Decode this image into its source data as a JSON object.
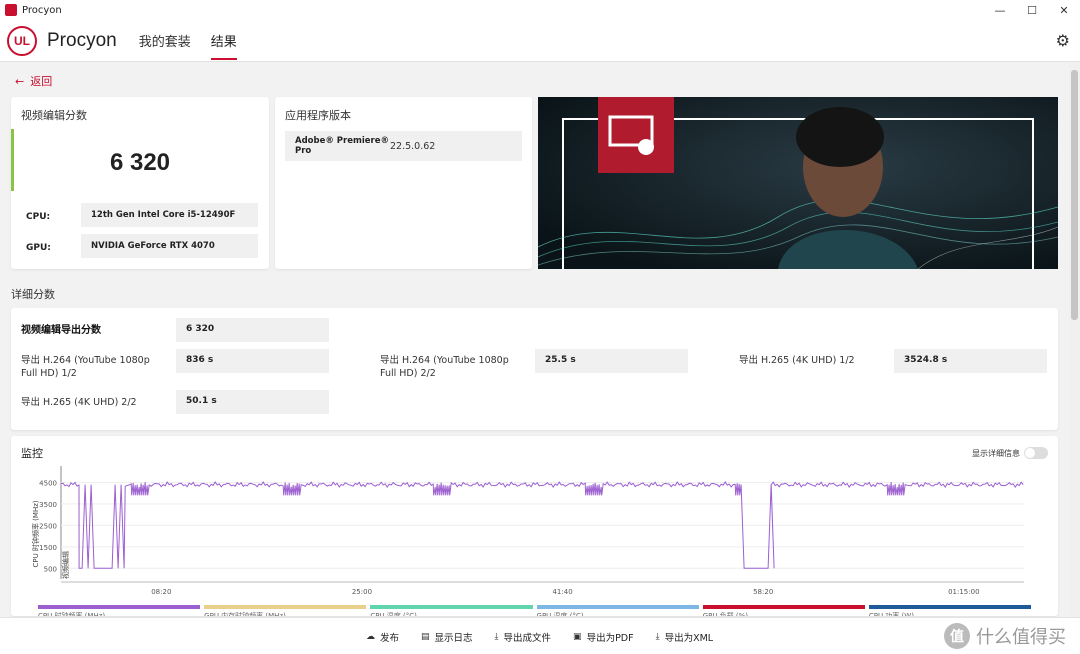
{
  "window": {
    "title": "Procyon",
    "controls": [
      "—",
      "☐",
      "✕"
    ]
  },
  "header": {
    "brand": "Procyon",
    "logo": "UL",
    "tabs": [
      {
        "label": "我的套装"
      },
      {
        "label": "结果"
      }
    ]
  },
  "back": {
    "label": "返回"
  },
  "score_card": {
    "title": "视频编辑分数",
    "score": "6 320",
    "cpu_label": "CPU:",
    "cpu_value": "12th Gen Intel Core i5-12490F",
    "gpu_label": "GPU:",
    "gpu_value": "NVIDIA GeForce RTX 4070"
  },
  "app_card": {
    "title": "应用程序版本",
    "app_name": "Adobe® Premiere® Pro",
    "app_version": "22.5.0.62"
  },
  "detail": {
    "section_title": "详细分数",
    "main_label": "视频编辑导出分数",
    "main_value": "6 320",
    "items": [
      {
        "label": "导出 H.264 (YouTube 1080p Full HD) 1/2",
        "value": "836 s"
      },
      {
        "label": "导出 H.264 (YouTube 1080p Full HD) 2/2",
        "value": "25.5 s"
      },
      {
        "label": "导出 H.265 (4K UHD) 1/2",
        "value": "3524.8 s"
      },
      {
        "label": "导出 H.265 (4K UHD) 2/2",
        "value": "50.1 s"
      }
    ]
  },
  "monitor": {
    "title": "监控",
    "toggle_label": "显示详细信息",
    "legend": [
      {
        "label": "CPU 时钟频率 (MHz)",
        "color": "#9c5fd0"
      },
      {
        "label": "GPU 内存时钟频率 (MHz)",
        "color": "#e8cf8a"
      },
      {
        "label": "CPU 温度 (°C)",
        "color": "#5fd6b0"
      },
      {
        "label": "GPU 温度 (°C)",
        "color": "#7db7e6"
      },
      {
        "label": "GPU 负载 (%)",
        "color": "#c8102e"
      },
      {
        "label": "CPU 功率 (W)",
        "color": "#1e5a99"
      }
    ]
  },
  "chart_data": {
    "type": "line",
    "ylabel": "CPU 时钟频率 (MHz)",
    "annotation": "视频编辑",
    "yticks": [
      500,
      1500,
      2500,
      3500,
      4500
    ],
    "ylim": [
      0,
      4800
    ],
    "xticks": [
      "08:20",
      "25:00",
      "41:40",
      "58:20",
      "01:15:00"
    ],
    "series": [
      {
        "name": "CPU 时钟频率 (MHz)",
        "color": "#9c5fd0",
        "segments": [
          {
            "start": "00:00",
            "end": "01:30",
            "value": 4400
          },
          {
            "start": "01:30",
            "end": "05:20",
            "value": 500
          },
          {
            "start": "05:20",
            "end": "56:30",
            "value": 4400
          },
          {
            "start": "56:30",
            "end": "59:00",
            "value": 500
          },
          {
            "start": "59:00",
            "end": "01:20:00",
            "value": 4400
          }
        ]
      }
    ]
  },
  "footer": {
    "actions": [
      {
        "icon": "upload-icon",
        "label": "发布"
      },
      {
        "icon": "document-icon",
        "label": "显示日志"
      },
      {
        "icon": "download-icon",
        "label": "导出成文件"
      },
      {
        "icon": "pdf-icon",
        "label": "导出为PDF"
      },
      {
        "icon": "download-icon",
        "label": "导出为XML"
      }
    ],
    "watermark": "什么值得买"
  }
}
